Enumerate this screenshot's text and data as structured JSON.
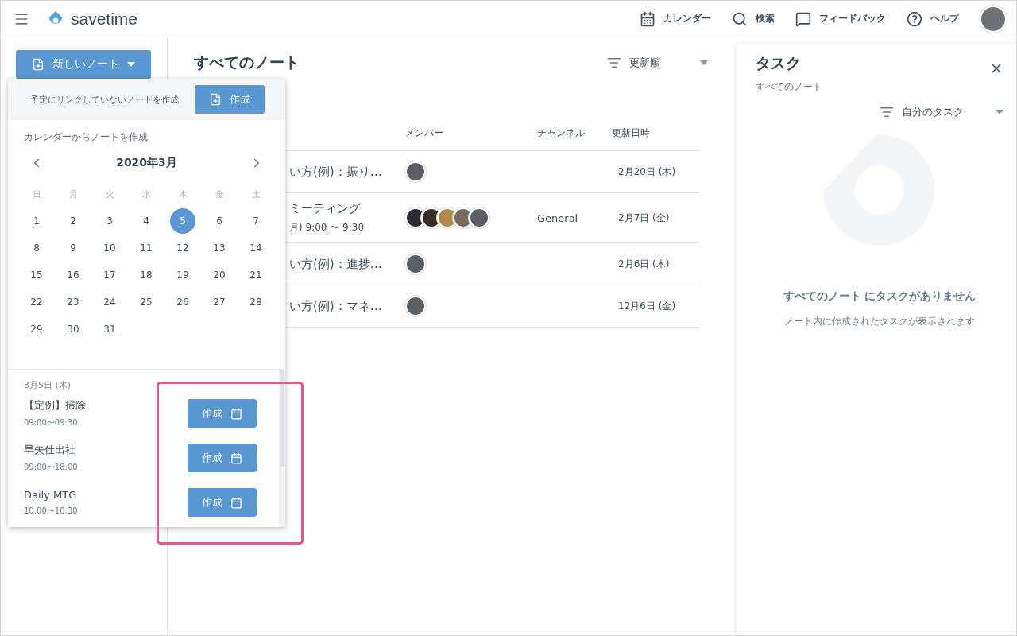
{
  "app": {
    "brand": "savetime"
  },
  "nav": [
    {
      "kind": "calendar",
      "label": "カレンダー"
    },
    {
      "kind": "search",
      "label": "検索"
    },
    {
      "kind": "feedback",
      "label": "フィードバック"
    },
    {
      "kind": "help",
      "label": "ヘルプ"
    }
  ],
  "new_note_button": {
    "label": "新しいノート"
  },
  "new_note_menu": {
    "unlinked_text": "予定にリンクしていないノートを作成",
    "unlinked_button": "作成",
    "calendar_caption": "カレンダーからノートを作成",
    "month": "2020年3月",
    "weekdays": [
      "日",
      "月",
      "火",
      "水",
      "木",
      "金",
      "土"
    ],
    "days": [
      {
        "label": "1",
        "selected": false
      },
      {
        "label": "2",
        "selected": false
      },
      {
        "label": "3",
        "selected": false
      },
      {
        "label": "4",
        "selected": false
      },
      {
        "label": "5",
        "selected": true
      },
      {
        "label": "6",
        "selected": false
      },
      {
        "label": "7",
        "selected": false
      },
      {
        "label": "8",
        "selected": false
      },
      {
        "label": "9",
        "selected": false
      },
      {
        "label": "10",
        "selected": false
      },
      {
        "label": "11",
        "selected": false
      },
      {
        "label": "12",
        "selected": false
      },
      {
        "label": "13",
        "selected": false
      },
      {
        "label": "14",
        "selected": false
      },
      {
        "label": "15",
        "selected": false
      },
      {
        "label": "16",
        "selected": false
      },
      {
        "label": "17",
        "selected": false
      },
      {
        "label": "18",
        "selected": false
      },
      {
        "label": "19",
        "selected": false
      },
      {
        "label": "20",
        "selected": false
      },
      {
        "label": "21",
        "selected": false
      },
      {
        "label": "22",
        "selected": false
      },
      {
        "label": "23",
        "selected": false
      },
      {
        "label": "24",
        "selected": false
      },
      {
        "label": "25",
        "selected": false
      },
      {
        "label": "26",
        "selected": false
      },
      {
        "label": "27",
        "selected": false
      },
      {
        "label": "28",
        "selected": false
      },
      {
        "label": "29",
        "selected": false
      },
      {
        "label": "30",
        "selected": false
      },
      {
        "label": "31",
        "selected": false
      }
    ],
    "events_date": "3月5日 (木)",
    "events": [
      {
        "title": "【定例】掃除",
        "time": "09:00〜09:30",
        "button": "作成"
      },
      {
        "title": "早矢仕出社",
        "time": "09:00〜18:00",
        "button": "作成"
      },
      {
        "title": "Daily MTG",
        "time": "10:00〜10:30",
        "button": "作成"
      }
    ]
  },
  "notes": {
    "title": "すべてのノート",
    "sort": "更新順",
    "columns": [
      "メンバー",
      "チャンネル",
      "更新日時"
    ],
    "rows": [
      {
        "title": "い方(例)：振り…",
        "members": [
          {
            "color": "#5a5f66"
          }
        ],
        "channel": "",
        "updated": "2月20日 (木)"
      },
      {
        "title": "ミーティング",
        "subtitle": "月) 9:00 〜 9:30",
        "members": [
          {
            "color": "#2b2b30"
          },
          {
            "color": "#3a2c25"
          },
          {
            "color": "#b08a4a"
          },
          {
            "color": "#7b6a60"
          },
          {
            "color": "#5a5f66"
          }
        ],
        "channel": "General",
        "updated": "2月7日 (金)"
      },
      {
        "title": "い方(例)：進捗…",
        "members": [
          {
            "color": "#5a5f66"
          }
        ],
        "channel": "",
        "updated": "2月6日 (木)"
      },
      {
        "title": "い方(例)：マネ…",
        "members": [
          {
            "color": "#5a5f66"
          }
        ],
        "channel": "",
        "updated": "12月6日 (金)"
      }
    ]
  },
  "tasks": {
    "title": "タスク",
    "subtitle": "すべてのノート",
    "filter": "自分のタスク",
    "empty_title": "すべてのノート にタスクがありません",
    "empty_text": "ノート内に作成されたタスクが表示されます"
  }
}
